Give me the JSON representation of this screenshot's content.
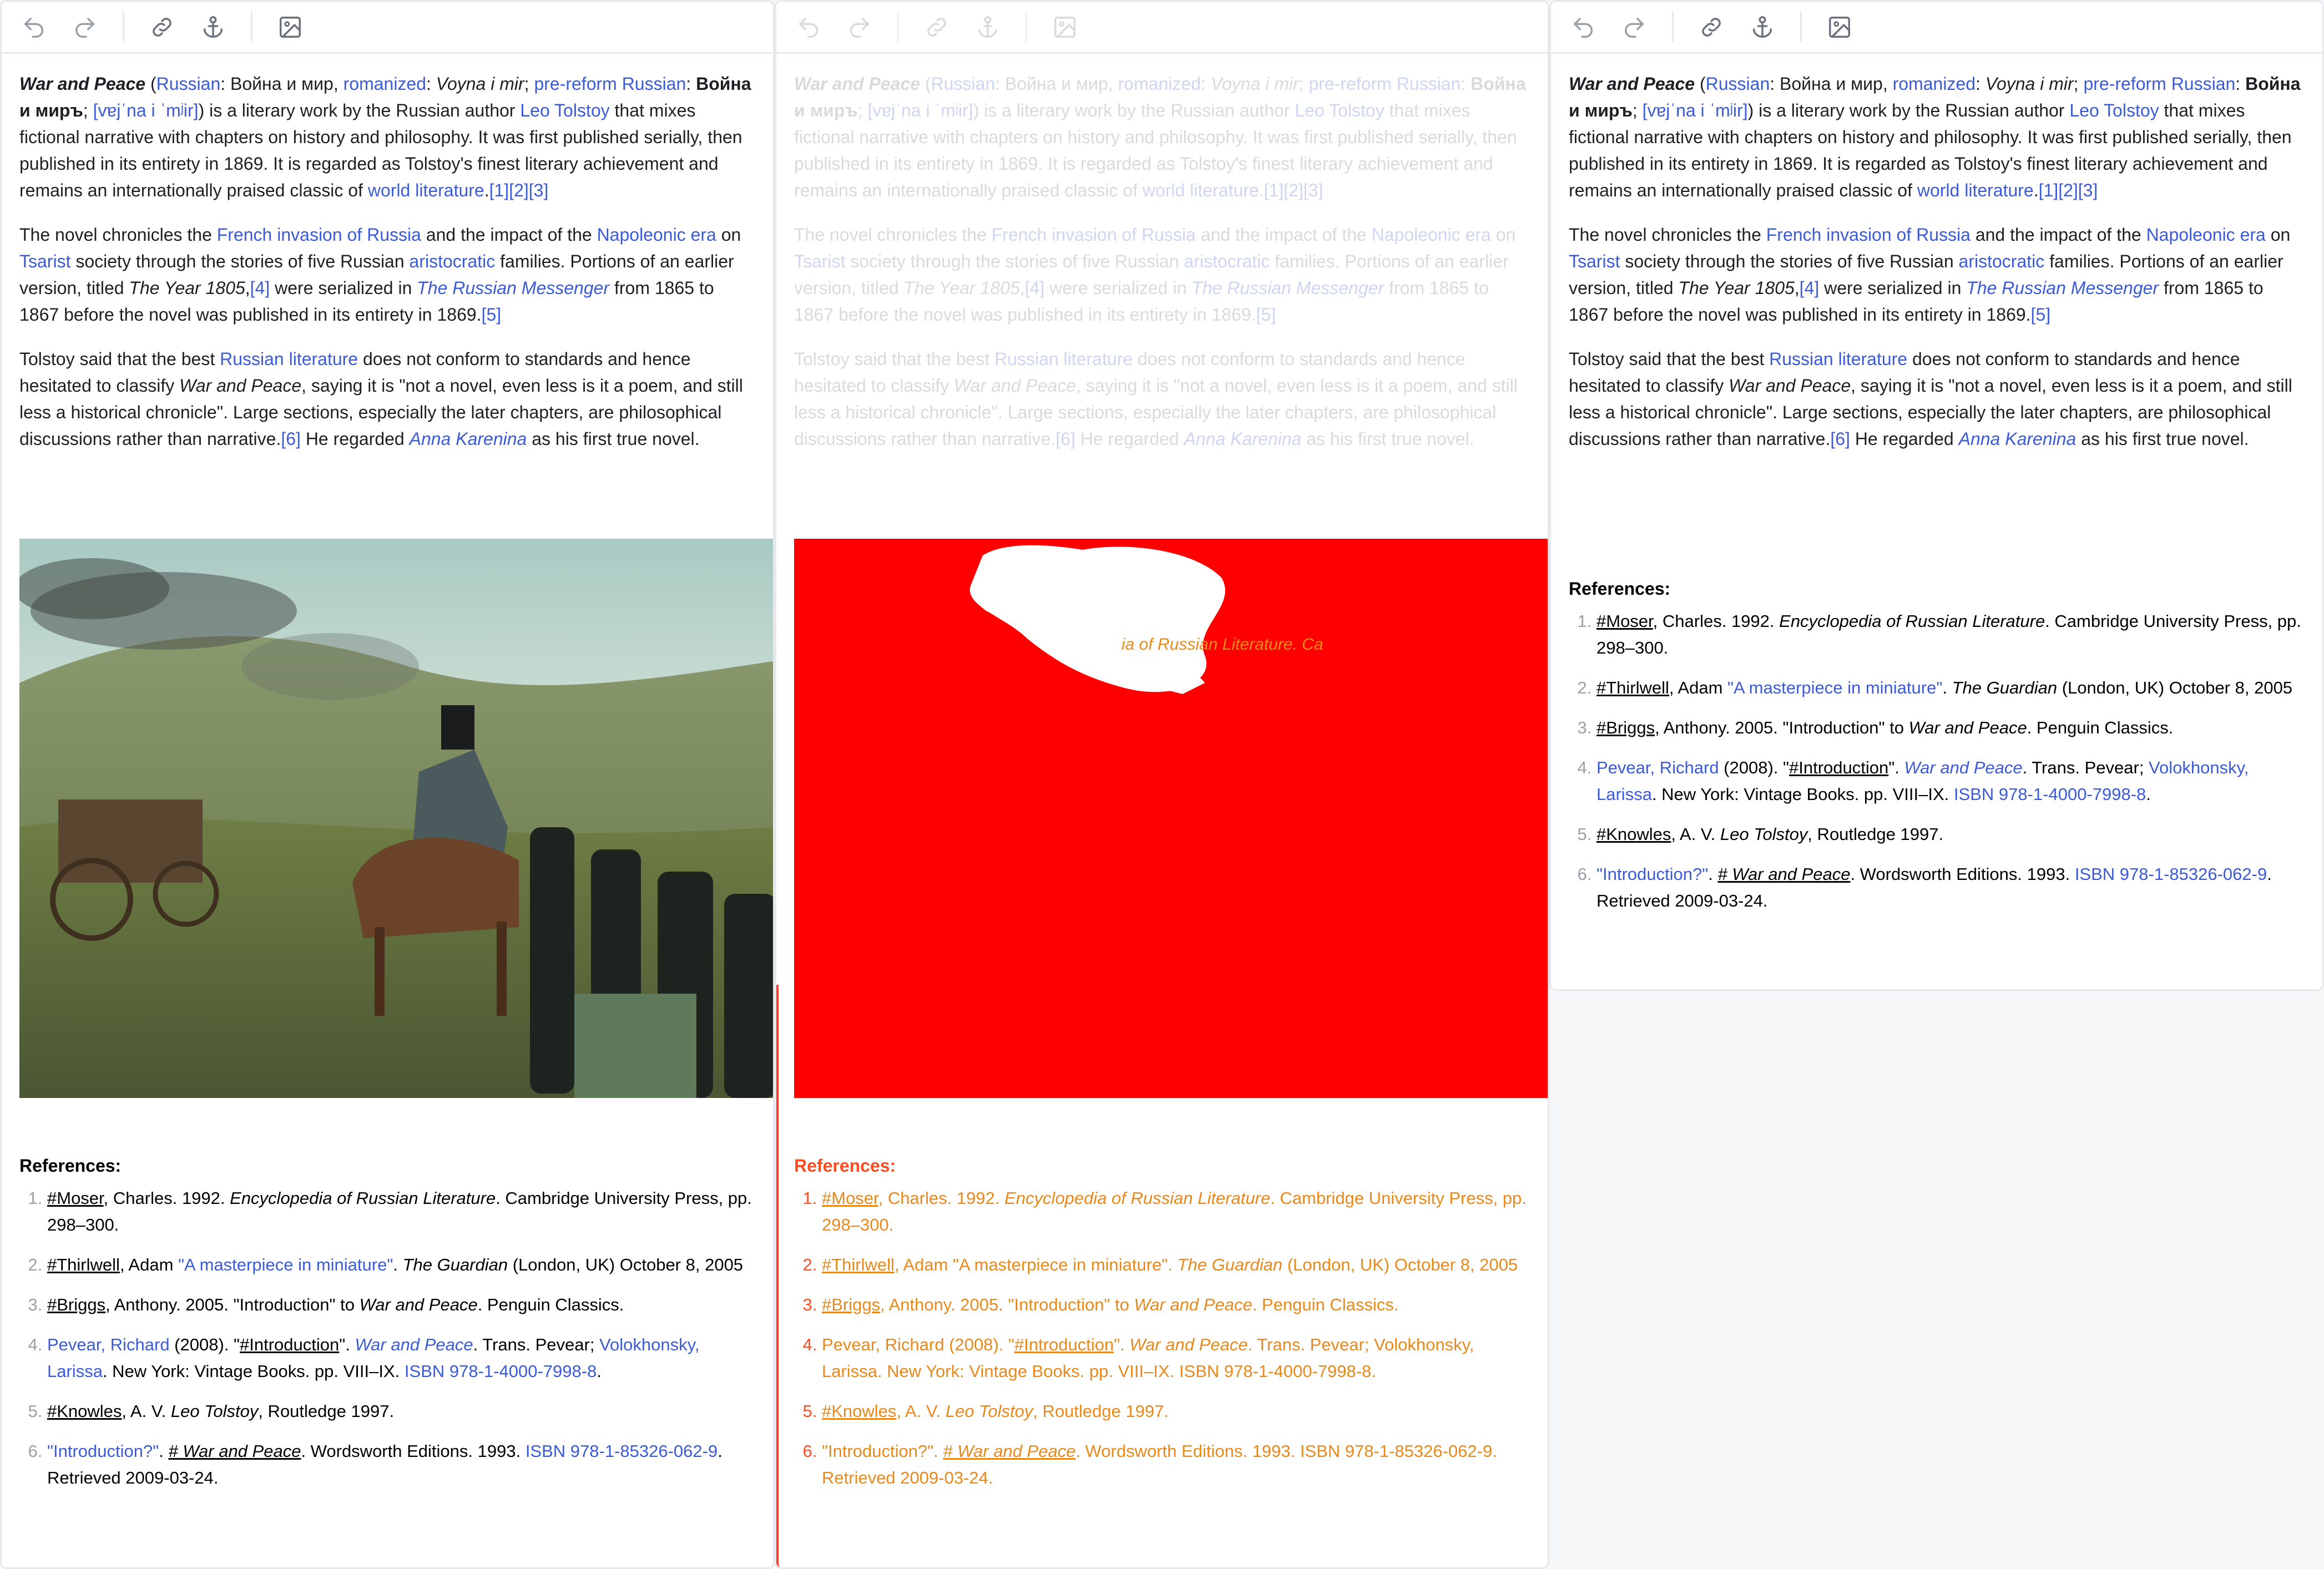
{
  "toolbar": {
    "buttons": [
      "undo-icon",
      "redo-icon",
      "link-icon",
      "anchor-icon",
      "image-icon"
    ]
  },
  "article": {
    "p1": {
      "title": "War and Peace",
      "t1": " (",
      "russian_link": "Russian",
      "t2": ": Война и мир, ",
      "romanized_link": "romanized",
      "t3": ": ",
      "romanized": "Voyna i mir",
      "t4": "; ",
      "prereform_link": "pre-reform Russian",
      "t5": ": ",
      "prereform": "Война и миръ",
      "t6": "; ",
      "ipa": "[vɐjˈna i ˈmʲir]",
      "t7": ") is a literary work by the Russian author ",
      "author_link": "Leo Tolstoy",
      "t8": " that mixes fictional narrative with chapters on history and philosophy. It was first published serially, then published in its entirety in 1869. It is regarded as Tolstoy's finest literary achievement and remains an internationally praised classic of ",
      "worldlit_link": "world literature",
      "t9": ".",
      "cite": "[1][2][3]"
    },
    "p2": {
      "t1": "The novel chronicles the ",
      "link1": "French invasion of Russia",
      "t2": " and the impact of the ",
      "link2": "Napoleonic era",
      "t3": " on ",
      "link3": "Tsarist",
      "t4": " society through the stories of five Russian ",
      "link4": "aristocratic",
      "t5": " families. Portions of an earlier version, titled ",
      "title2": "The Year 1805",
      "t6": ",",
      "cite4": "[4]",
      "t7": " were serialized in ",
      "link5": "The Russian Messenger",
      "t8": " from 1865 to 1867 before the novel was published in its entirety in 1869.",
      "cite5": "[5]"
    },
    "p3": {
      "t1": "Tolstoy said that the best ",
      "link1": "Russian literature",
      "t2": " does not conform to standards and hence hesitated to classify ",
      "title": "War and Peace",
      "t3": ", saying it is \"not a novel, even less is it a poem, and still less a historical chronicle\". Large sections, especially the later chapters, are philosophical discussions rather than narrative.",
      "cite6": "[6]",
      "t4": " He regarded ",
      "link2": "Anna Karenina",
      "t5": " as his first true novel."
    }
  },
  "references": {
    "title": "References",
    "colon": ":",
    "items": [
      {
        "a": "#Moser",
        "b": ", Charles. 1992. ",
        "c": "Encyclopedia of Russian Literature",
        "d": ". Cambridge University Press, pp. 298–300."
      },
      {
        "a": "#Thirlwell",
        "b": ", Adam ",
        "c": "\"A masterpiece in miniature\"",
        "d": ". ",
        "e": "The Guardian",
        "f": " (London, UK) October 8, 2005"
      },
      {
        "a": "#Briggs",
        "b": ", Anthony. 2005. \"Introduction\" to ",
        "c": "War and Peace",
        "d": ". Penguin Classics."
      },
      {
        "a": "Pevear, Richard",
        "b": " (2008). \"",
        "c": "#Introduction",
        "d": "\". ",
        "e": "War and Peace",
        "f": ". Trans. Pevear; ",
        "g": "Volokhonsky, Larissa",
        "h": ". New York: Vintage Books. pp. VIII–IX. ",
        "i": "ISBN 978-1-4000-7998-8",
        "j": "."
      },
      {
        "a": "#Knowles",
        "b": ", A. V. ",
        "c": "Leo Tolstoy",
        "d": ", Routledge 1997."
      },
      {
        "a": "\"Introduction?\"",
        "b": ". ",
        "c": "# War and Peace",
        "d": ". Wordsworth Editions. 1993. ",
        "e": "ISBN 978-1-85326-062-9",
        "f": ". Retrieved 2009-03-24."
      }
    ]
  },
  "mid_overlay_text": "ia of Russian Literature. Ca"
}
